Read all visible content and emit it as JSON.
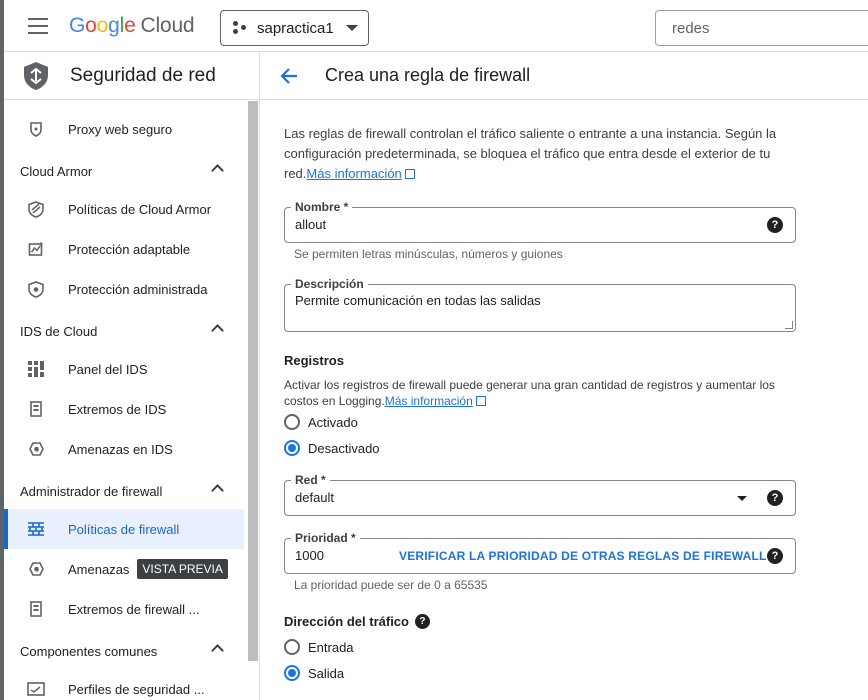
{
  "topbar": {
    "brand_letters": [
      "G",
      "o",
      "o",
      "g",
      "l",
      "e"
    ],
    "brand_product": "Cloud",
    "project": "sapractica1",
    "search_placeholder": "redes"
  },
  "sidebar": {
    "title": "Seguridad de red",
    "items": [
      {
        "label": "Proxy web seguro",
        "icon": "proxy-icon"
      },
      {
        "section": "Cloud Armor"
      },
      {
        "label": "Políticas de Cloud Armor",
        "icon": "shield-icon"
      },
      {
        "label": "Protección adaptable",
        "icon": "adaptive-icon"
      },
      {
        "label": "Protección administrada",
        "icon": "managed-shield-icon"
      },
      {
        "section": "IDS de Cloud"
      },
      {
        "label": "Panel del IDS",
        "icon": "dashboard-icon"
      },
      {
        "label": "Extremos de IDS",
        "icon": "endpoint-icon"
      },
      {
        "label": "Amenazas en IDS",
        "icon": "threat-icon"
      },
      {
        "section": "Administrador de firewall"
      },
      {
        "label": "Políticas de firewall",
        "icon": "firewall-icon",
        "active": true
      },
      {
        "label": "Amenazas",
        "icon": "threat-icon",
        "badge": "VISTA PREVIA"
      },
      {
        "label": "Extremos de firewall ...",
        "icon": "endpoint-icon"
      },
      {
        "section": "Componentes comunes"
      },
      {
        "label": "Perfiles de seguridad ...",
        "icon": "profile-icon"
      }
    ]
  },
  "main": {
    "title": "Crea una regla de firewall",
    "intro": "Las reglas de firewall controlan el tráfico saliente o entrante a una instancia. Según la configuración predeterminada, se bloquea el tráfico que entra desde el exterior de tu red.",
    "intro_link": "Más información",
    "name_label": "Nombre *",
    "name_value": "allout",
    "name_hint": "Se permiten letras minúsculas, números y guiones",
    "desc_label": "Descripción",
    "desc_value": "Permite comunicación en todas las salidas",
    "logs_title": "Registros",
    "logs_text": "Activar los registros de firewall puede generar una gran cantidad de registros y aumentar los costos en Logging.",
    "logs_link": "Más información",
    "logs_on": "Activado",
    "logs_off": "Desactivado",
    "network_label": "Red *",
    "network_value": "default",
    "priority_label": "Prioridad *",
    "priority_value": "1000",
    "priority_check": "VERIFICAR LA PRIORIDAD DE OTRAS REGLAS DE FIREWALL",
    "priority_hint": "La prioridad puede ser de 0 a 65535",
    "direction_title": "Dirección del tráfico",
    "direction_in": "Entrada",
    "direction_out": "Salida",
    "help_glyph": "?"
  },
  "colors": {
    "accent": "#1a73e8",
    "active_bg": "#e8f0fe"
  }
}
